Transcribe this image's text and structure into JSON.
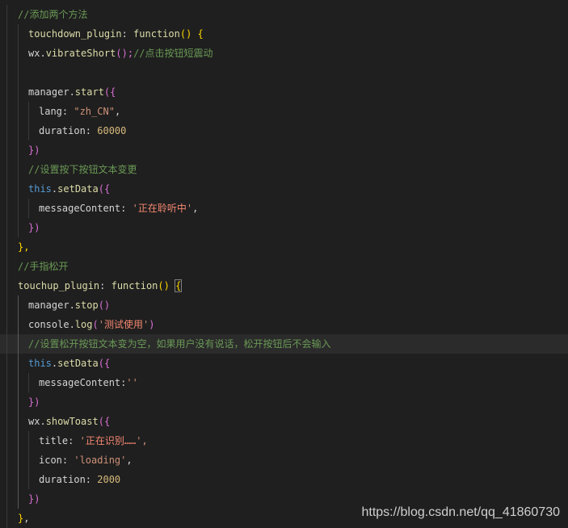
{
  "editor": {
    "lines": [
      {
        "indent": 1,
        "tokens": [
          {
            "t": "//添加两个方法",
            "c": "cm"
          }
        ]
      },
      {
        "indent": 2,
        "tokens": [
          {
            "t": "touchdown_plugin",
            "c": "fn"
          },
          {
            "t": ": ",
            "c": "pu"
          },
          {
            "t": "function",
            "c": "kw"
          },
          {
            "t": "() ",
            "c": "br-y"
          },
          {
            "t": "{",
            "c": "br-y"
          }
        ]
      },
      {
        "indent": 2,
        "tokens": [
          {
            "t": "wx.",
            "c": "pr"
          },
          {
            "t": "vibrateShort",
            "c": "fn"
          },
          {
            "t": "();",
            "c": "br-p"
          },
          {
            "t": "//点击按钮短震动",
            "c": "cm"
          }
        ]
      },
      {
        "indent": 2,
        "tokens": []
      },
      {
        "indent": 2,
        "tokens": [
          {
            "t": "manager.",
            "c": "pr"
          },
          {
            "t": "start",
            "c": "fn"
          },
          {
            "t": "({",
            "c": "br-p"
          }
        ]
      },
      {
        "indent": 3,
        "tokens": [
          {
            "t": "lang: ",
            "c": "pr"
          },
          {
            "t": "\"zh_CN\"",
            "c": "str"
          },
          {
            "t": ",",
            "c": "pu"
          }
        ]
      },
      {
        "indent": 3,
        "tokens": [
          {
            "t": "duration: ",
            "c": "pr"
          },
          {
            "t": "60000",
            "c": "num"
          }
        ]
      },
      {
        "indent": 2,
        "tokens": [
          {
            "t": "})",
            "c": "br-p"
          }
        ]
      },
      {
        "indent": 2,
        "tokens": [
          {
            "t": "//设置按下按钮文本变更",
            "c": "cm"
          }
        ]
      },
      {
        "indent": 2,
        "tokens": [
          {
            "t": "this",
            "c": "this"
          },
          {
            "t": ".",
            "c": "pu"
          },
          {
            "t": "setData",
            "c": "fn"
          },
          {
            "t": "({",
            "c": "br-p"
          }
        ]
      },
      {
        "indent": 3,
        "tokens": [
          {
            "t": "messageContent: ",
            "c": "pr"
          },
          {
            "t": "'",
            "c": "str"
          },
          {
            "t": "正在聆听中",
            "c": "strz"
          },
          {
            "t": "'",
            "c": "str"
          },
          {
            "t": ",",
            "c": "pu"
          }
        ]
      },
      {
        "indent": 2,
        "tokens": [
          {
            "t": "})",
            "c": "br-p"
          }
        ]
      },
      {
        "indent": 1,
        "tokens": [
          {
            "t": "},",
            "c": "br-y"
          }
        ]
      },
      {
        "indent": 1,
        "tokens": [
          {
            "t": "//手指松开",
            "c": "cm"
          }
        ]
      },
      {
        "indent": 1,
        "tokens": [
          {
            "t": "touchup_plugin",
            "c": "fn"
          },
          {
            "t": ": ",
            "c": "pu"
          },
          {
            "t": "function",
            "c": "kw"
          },
          {
            "t": "() ",
            "c": "br-y"
          },
          {
            "t": "{",
            "c": "br-y",
            "box": true
          }
        ]
      },
      {
        "indent": 2,
        "tokens": [
          {
            "t": "manager.",
            "c": "pr"
          },
          {
            "t": "stop",
            "c": "fn"
          },
          {
            "t": "()",
            "c": "br-p"
          }
        ]
      },
      {
        "indent": 2,
        "tokens": [
          {
            "t": "console.",
            "c": "pr"
          },
          {
            "t": "log",
            "c": "fn"
          },
          {
            "t": "(",
            "c": "br-p"
          },
          {
            "t": "'",
            "c": "str"
          },
          {
            "t": "测试使用",
            "c": "strz"
          },
          {
            "t": "'",
            "c": "str"
          },
          {
            "t": ")",
            "c": "br-p"
          }
        ]
      },
      {
        "indent": 2,
        "hl": true,
        "tokens": [
          {
            "t": "//设置松开按钮文本变为空，如果用户没有说话，松开按钮后不会输入",
            "c": "cm"
          }
        ]
      },
      {
        "indent": 2,
        "tokens": [
          {
            "t": "this",
            "c": "this"
          },
          {
            "t": ".",
            "c": "pu"
          },
          {
            "t": "setData",
            "c": "fn"
          },
          {
            "t": "({",
            "c": "br-p"
          }
        ]
      },
      {
        "indent": 3,
        "tokens": [
          {
            "t": "messageContent:",
            "c": "pr"
          },
          {
            "t": "''",
            "c": "str"
          }
        ]
      },
      {
        "indent": 2,
        "tokens": [
          {
            "t": "})",
            "c": "br-p"
          }
        ]
      },
      {
        "indent": 2,
        "tokens": [
          {
            "t": "wx.",
            "c": "pr"
          },
          {
            "t": "showToast",
            "c": "fn"
          },
          {
            "t": "({",
            "c": "br-p"
          }
        ]
      },
      {
        "indent": 3,
        "tokens": [
          {
            "t": "title: ",
            "c": "pr"
          },
          {
            "t": "'",
            "c": "str"
          },
          {
            "t": "正在识别……",
            "c": "strz"
          },
          {
            "t": "',",
            "c": "str"
          }
        ]
      },
      {
        "indent": 3,
        "tokens": [
          {
            "t": "icon: ",
            "c": "pr"
          },
          {
            "t": "'loading'",
            "c": "str"
          },
          {
            "t": ",",
            "c": "pu"
          }
        ]
      },
      {
        "indent": 3,
        "tokens": [
          {
            "t": "duration: ",
            "c": "pr"
          },
          {
            "t": "2000",
            "c": "num"
          }
        ]
      },
      {
        "indent": 2,
        "tokens": [
          {
            "t": "})",
            "c": "br-p"
          }
        ]
      },
      {
        "indent": 1,
        "tokens": [
          {
            "t": "}",
            "c": "br-y"
          },
          {
            "t": ",",
            "c": "pu"
          }
        ]
      }
    ]
  },
  "watermark": "https://blog.csdn.net/qq_41860730"
}
